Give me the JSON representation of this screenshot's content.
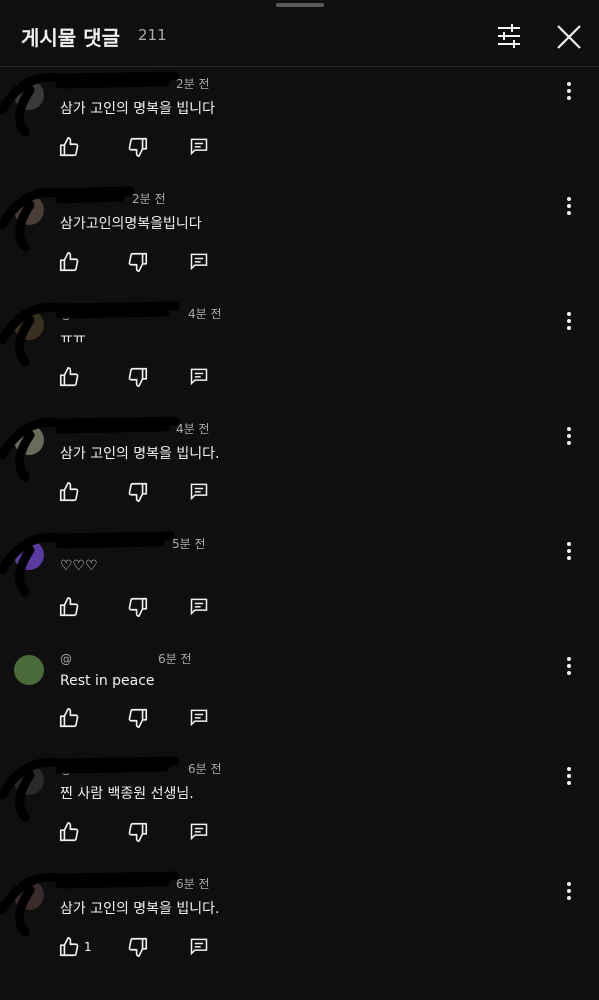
{
  "header": {
    "title": "게시물 댓글",
    "count": "211"
  },
  "comments": [
    {
      "handle": "",
      "time": "2분 전",
      "text": "삼가 고인의 명복을 빕니다",
      "likes": ""
    },
    {
      "handle": "",
      "time": "2분 전",
      "text": "삼가고인의명복을빕니다",
      "likes": ""
    },
    {
      "handle": "@",
      "time": "4분 전",
      "text": "ㅠㅠ",
      "likes": ""
    },
    {
      "handle": "",
      "time": "4분 전",
      "text": "삼가 고인의 명복을 빕니다.",
      "likes": ""
    },
    {
      "handle": "",
      "time": "5분 전",
      "text": "♡♡♡",
      "likes": ""
    },
    {
      "handle": "@",
      "time": "6분 전",
      "text": "Rest in peace",
      "likes": ""
    },
    {
      "handle": "@",
      "time": "6분 전",
      "text": "찐 사람 백종원 선생님.",
      "likes": ""
    },
    {
      "handle": "",
      "time": "6분 전",
      "text": "삼가 고인의 명복을 빕니다.",
      "likes": "1"
    }
  ],
  "icons": {
    "filter": "tune-icon",
    "close": "close-icon",
    "like": "thumb-up-icon",
    "dislike": "thumb-down-icon",
    "reply": "reply-icon",
    "more": "more-vert-icon"
  },
  "colors": {
    "background": "#0f0f0f",
    "text": "#f1f1f1",
    "secondary_text": "#aaaaaa",
    "redaction": "#000000"
  }
}
